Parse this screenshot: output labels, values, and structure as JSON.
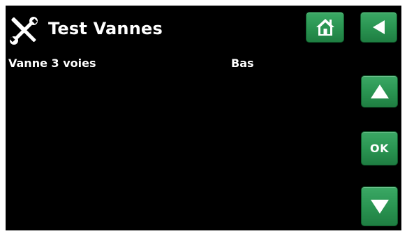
{
  "header": {
    "title": "Test Vannes",
    "icon": "tools-icon"
  },
  "rows": [
    {
      "label": "Vanne 3 voies",
      "value": "Bas"
    }
  ],
  "buttons": {
    "home_icon": "home-icon",
    "back_icon": "back-arrow-icon",
    "up_icon": "up-arrow-icon",
    "ok_label": "OK",
    "down_icon": "down-arrow-icon"
  },
  "colors": {
    "background": "#000000",
    "text": "#ffffff",
    "button_green": "#2a9552"
  }
}
